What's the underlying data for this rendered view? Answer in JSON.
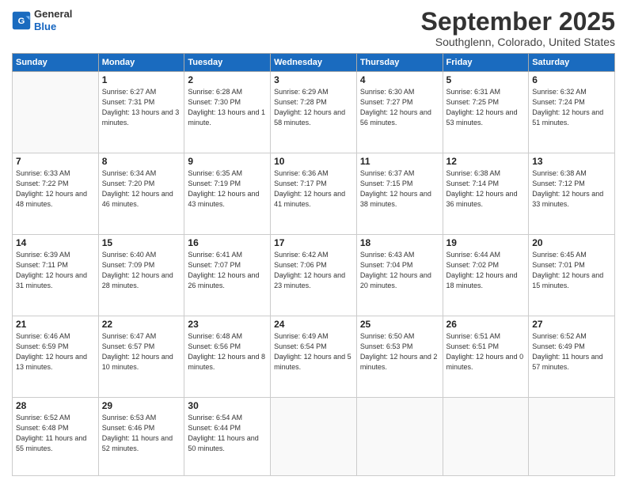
{
  "logo": {
    "line1": "General",
    "line2": "Blue"
  },
  "header": {
    "month": "September 2025",
    "location": "Southglenn, Colorado, United States"
  },
  "weekdays": [
    "Sunday",
    "Monday",
    "Tuesday",
    "Wednesday",
    "Thursday",
    "Friday",
    "Saturday"
  ],
  "weeks": [
    [
      {
        "day": "",
        "sunrise": "",
        "sunset": "",
        "daylight": ""
      },
      {
        "day": "1",
        "sunrise": "Sunrise: 6:27 AM",
        "sunset": "Sunset: 7:31 PM",
        "daylight": "Daylight: 13 hours and 3 minutes."
      },
      {
        "day": "2",
        "sunrise": "Sunrise: 6:28 AM",
        "sunset": "Sunset: 7:30 PM",
        "daylight": "Daylight: 13 hours and 1 minute."
      },
      {
        "day": "3",
        "sunrise": "Sunrise: 6:29 AM",
        "sunset": "Sunset: 7:28 PM",
        "daylight": "Daylight: 12 hours and 58 minutes."
      },
      {
        "day": "4",
        "sunrise": "Sunrise: 6:30 AM",
        "sunset": "Sunset: 7:27 PM",
        "daylight": "Daylight: 12 hours and 56 minutes."
      },
      {
        "day": "5",
        "sunrise": "Sunrise: 6:31 AM",
        "sunset": "Sunset: 7:25 PM",
        "daylight": "Daylight: 12 hours and 53 minutes."
      },
      {
        "day": "6",
        "sunrise": "Sunrise: 6:32 AM",
        "sunset": "Sunset: 7:24 PM",
        "daylight": "Daylight: 12 hours and 51 minutes."
      }
    ],
    [
      {
        "day": "7",
        "sunrise": "Sunrise: 6:33 AM",
        "sunset": "Sunset: 7:22 PM",
        "daylight": "Daylight: 12 hours and 48 minutes."
      },
      {
        "day": "8",
        "sunrise": "Sunrise: 6:34 AM",
        "sunset": "Sunset: 7:20 PM",
        "daylight": "Daylight: 12 hours and 46 minutes."
      },
      {
        "day": "9",
        "sunrise": "Sunrise: 6:35 AM",
        "sunset": "Sunset: 7:19 PM",
        "daylight": "Daylight: 12 hours and 43 minutes."
      },
      {
        "day": "10",
        "sunrise": "Sunrise: 6:36 AM",
        "sunset": "Sunset: 7:17 PM",
        "daylight": "Daylight: 12 hours and 41 minutes."
      },
      {
        "day": "11",
        "sunrise": "Sunrise: 6:37 AM",
        "sunset": "Sunset: 7:15 PM",
        "daylight": "Daylight: 12 hours and 38 minutes."
      },
      {
        "day": "12",
        "sunrise": "Sunrise: 6:38 AM",
        "sunset": "Sunset: 7:14 PM",
        "daylight": "Daylight: 12 hours and 36 minutes."
      },
      {
        "day": "13",
        "sunrise": "Sunrise: 6:38 AM",
        "sunset": "Sunset: 7:12 PM",
        "daylight": "Daylight: 12 hours and 33 minutes."
      }
    ],
    [
      {
        "day": "14",
        "sunrise": "Sunrise: 6:39 AM",
        "sunset": "Sunset: 7:11 PM",
        "daylight": "Daylight: 12 hours and 31 minutes."
      },
      {
        "day": "15",
        "sunrise": "Sunrise: 6:40 AM",
        "sunset": "Sunset: 7:09 PM",
        "daylight": "Daylight: 12 hours and 28 minutes."
      },
      {
        "day": "16",
        "sunrise": "Sunrise: 6:41 AM",
        "sunset": "Sunset: 7:07 PM",
        "daylight": "Daylight: 12 hours and 26 minutes."
      },
      {
        "day": "17",
        "sunrise": "Sunrise: 6:42 AM",
        "sunset": "Sunset: 7:06 PM",
        "daylight": "Daylight: 12 hours and 23 minutes."
      },
      {
        "day": "18",
        "sunrise": "Sunrise: 6:43 AM",
        "sunset": "Sunset: 7:04 PM",
        "daylight": "Daylight: 12 hours and 20 minutes."
      },
      {
        "day": "19",
        "sunrise": "Sunrise: 6:44 AM",
        "sunset": "Sunset: 7:02 PM",
        "daylight": "Daylight: 12 hours and 18 minutes."
      },
      {
        "day": "20",
        "sunrise": "Sunrise: 6:45 AM",
        "sunset": "Sunset: 7:01 PM",
        "daylight": "Daylight: 12 hours and 15 minutes."
      }
    ],
    [
      {
        "day": "21",
        "sunrise": "Sunrise: 6:46 AM",
        "sunset": "Sunset: 6:59 PM",
        "daylight": "Daylight: 12 hours and 13 minutes."
      },
      {
        "day": "22",
        "sunrise": "Sunrise: 6:47 AM",
        "sunset": "Sunset: 6:57 PM",
        "daylight": "Daylight: 12 hours and 10 minutes."
      },
      {
        "day": "23",
        "sunrise": "Sunrise: 6:48 AM",
        "sunset": "Sunset: 6:56 PM",
        "daylight": "Daylight: 12 hours and 8 minutes."
      },
      {
        "day": "24",
        "sunrise": "Sunrise: 6:49 AM",
        "sunset": "Sunset: 6:54 PM",
        "daylight": "Daylight: 12 hours and 5 minutes."
      },
      {
        "day": "25",
        "sunrise": "Sunrise: 6:50 AM",
        "sunset": "Sunset: 6:53 PM",
        "daylight": "Daylight: 12 hours and 2 minutes."
      },
      {
        "day": "26",
        "sunrise": "Sunrise: 6:51 AM",
        "sunset": "Sunset: 6:51 PM",
        "daylight": "Daylight: 12 hours and 0 minutes."
      },
      {
        "day": "27",
        "sunrise": "Sunrise: 6:52 AM",
        "sunset": "Sunset: 6:49 PM",
        "daylight": "Daylight: 11 hours and 57 minutes."
      }
    ],
    [
      {
        "day": "28",
        "sunrise": "Sunrise: 6:52 AM",
        "sunset": "Sunset: 6:48 PM",
        "daylight": "Daylight: 11 hours and 55 minutes."
      },
      {
        "day": "29",
        "sunrise": "Sunrise: 6:53 AM",
        "sunset": "Sunset: 6:46 PM",
        "daylight": "Daylight: 11 hours and 52 minutes."
      },
      {
        "day": "30",
        "sunrise": "Sunrise: 6:54 AM",
        "sunset": "Sunset: 6:44 PM",
        "daylight": "Daylight: 11 hours and 50 minutes."
      },
      {
        "day": "",
        "sunrise": "",
        "sunset": "",
        "daylight": ""
      },
      {
        "day": "",
        "sunrise": "",
        "sunset": "",
        "daylight": ""
      },
      {
        "day": "",
        "sunrise": "",
        "sunset": "",
        "daylight": ""
      },
      {
        "day": "",
        "sunrise": "",
        "sunset": "",
        "daylight": ""
      }
    ]
  ]
}
